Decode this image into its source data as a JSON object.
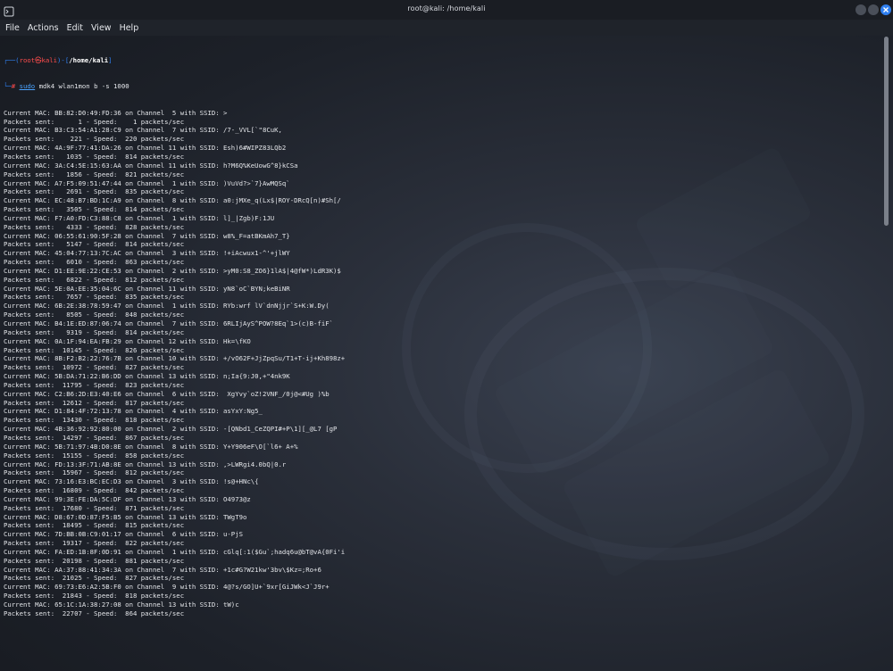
{
  "window": {
    "title": "root@kali: /home/kali"
  },
  "menu": [
    "File",
    "Actions",
    "Edit",
    "View",
    "Help"
  ],
  "prompt": {
    "top_left": "┌──(",
    "user_host": "root㉿kali",
    "mid": ")-[",
    "path": "/home/kali",
    "top_right": "]",
    "bottom": "└─",
    "symbol": "# ",
    "command": "sudo",
    "args": " mdk4 wlan1mon b -s 1000"
  },
  "output_lines": [
    "Current MAC: BB:82:D0:49:FD:36 on Channel  5 with SSID: >",
    "Packets sent:      1 - Speed:    1 packets/sec",
    "Current MAC: B3:C3:54:A1:28:C9 on Channel  7 with SSID: /7-_VVL[`\"8CuK,",
    "Packets sent:    221 - Speed:  220 packets/sec",
    "Current MAC: 4A:9F:77:41:DA:26 on Channel 11 with SSID: Esh)6#WIPZ83LQb2",
    "Packets sent:   1035 - Speed:  814 packets/sec",
    "Current MAC: 3A:C4:5E:15:63:AA on Channel 11 with SSID: h?M6Q%KeUowG^8}kCSa",
    "Packets sent:   1856 - Speed:  821 packets/sec",
    "Current MAC: A7:F5:09:51:47:44 on Channel  1 with SSID: )VuVd?>`7}AwMQSq`",
    "Packets sent:   2691 - Speed:  835 packets/sec",
    "Current MAC: EC:48:B7:BD:1C:A9 on Channel  8 with SSID: a0:jMXe_q(Lx$|ROY-DRcQ[n)#Sh[/",
    "Packets sent:   3505 - Speed:  814 packets/sec",
    "Current MAC: F7:A0:FD:C3:88:C8 on Channel  1 with SSID: l]_|Zgb)F:1JU",
    "Packets sent:   4333 - Speed:  828 packets/sec",
    "Current MAC: 06:55:61:90:5F:28 on Channel  7 with SSID: w8%_F=atBKmAh7_T}",
    "Packets sent:   5147 - Speed:  814 packets/sec",
    "Current MAC: 45:04:77:13:7C:AC on Channel  3 with SSID: !+iAcwux1-^'+jlWY",
    "Packets sent:   6010 - Speed:  863 packets/sec",
    "Current MAC: D1:EE:9E:22:CE:53 on Channel  2 with SSID: >yM0:S8_ZO6}1lA$|4@fW*)LdR3K)$",
    "Packets sent:   6822 - Speed:  812 packets/sec",
    "Current MAC: 5E:0A:EE:35:04:6C on Channel 11 with SSID: yN8`oC`BYN;keBiNR",
    "Packets sent:   7657 - Speed:  835 packets/sec",
    "Current MAC: 6B:2E:38:78:59:47 on Channel  1 with SSID: RYb:wrf lV`dnNjjr`S+K:W.Dy(",
    "Packets sent:   8505 - Speed:  848 packets/sec",
    "Current MAC: B4:1E:ED:87:06:74 on Channel  7 with SSID: 6RLIjAyS^POW?8Eq`1>(c)B-fiF`",
    "Packets sent:   9319 - Speed:  814 packets/sec",
    "Current MAC: 0A:1F:94:EA:FB:29 on Channel 12 with SSID: Hk=\\fKO",
    "Packets sent:  10145 - Speed:  826 packets/sec",
    "Current MAC: 8B:F2:B2:22:76:7B on Channel 10 with SSID: +/vO62F+JjZpqSu/T1+T-ij+Kh898z+",
    "Packets sent:  10972 - Speed:  827 packets/sec",
    "Current MAC: 5B:DA:71:22:B6:DD on Channel 13 with SSID: n;Ia{9:J0,+\"4nk9K",
    "Packets sent:  11795 - Speed:  823 packets/sec",
    "Current MAC: C2:B6:2D:E3:40:E6 on Channel  6 with SSID:  XgYvy`oZ!2VNF_/0j@<#Ug )%b",
    "Packets sent:  12612 - Speed:  817 packets/sec",
    "Current MAC: D1:84:4F:72:13:78 on Channel  4 with SSID: asYxY:Ng5_",
    "Packets sent:  13430 - Speed:  818 packets/sec",
    "Current MAC: 4B:36:92:92:80:00 on Channel  2 with SSID: -[QNbd1_CeZQPI#+P\\1][_@L7 [gP",
    "Packets sent:  14297 - Speed:  867 packets/sec",
    "Current MAC: 5B:71:97:4B:D0:8E on Channel  8 with SSID: Y+Y906eF\\O[`l6+ A+%",
    "Packets sent:  15155 - Speed:  858 packets/sec",
    "Current MAC: FD:13:3F:71:AB:8E on Channel 13 with SSID: ,>LWRgi4.0bQ|0.r",
    "Packets sent:  15967 - Speed:  812 packets/sec",
    "Current MAC: 73:16:E3:BC:EC:D3 on Channel  3 with SSID: !s@+HNc\\{",
    "Packets sent:  16809 - Speed:  842 packets/sec",
    "Current MAC: 99:3E:FE:DA:5C:DF on Channel 13 with SSID: O4973@z",
    "Packets sent:  17680 - Speed:  871 packets/sec",
    "Current MAC: D8:67:0D:87:F5:B5 on Channel 13 with SSID: TWgT9o",
    "Packets sent:  18495 - Speed:  815 packets/sec",
    "Current MAC: 7D:BB:0B:C9:01:17 on Channel  6 with SSID: u-PjS",
    "Packets sent:  19317 - Speed:  822 packets/sec",
    "Current MAC: FA:ED:1B:8F:0D:91 on Channel  1 with SSID: cGlq[:1($Gu`;hadq6u@bT@vA{0Fi'i",
    "Packets sent:  20198 - Speed:  881 packets/sec",
    "Current MAC: AA:37:88:41:34:3A on Channel  7 with SSID: +1c#G?W21kw'3bv\\$Kz=;Ro+6",
    "Packets sent:  21025 - Speed:  827 packets/sec",
    "Current MAC: 69:73:E6:A2:5B:F0 on Channel  9 with SSID: 4@?s/GO]U+`9xr[GiJWk<J`J9r+",
    "Packets sent:  21843 - Speed:  818 packets/sec",
    "Current MAC: 65:1C:1A:38:27:08 on Channel 13 with SSID: tW)c",
    "Packets sent:  22707 - Speed:  864 packets/sec"
  ],
  "colors": {
    "accent": "#2f7ff0",
    "user": "#ff4d4d"
  },
  "icons": {
    "app": "terminal-icon",
    "close": "close-icon"
  }
}
